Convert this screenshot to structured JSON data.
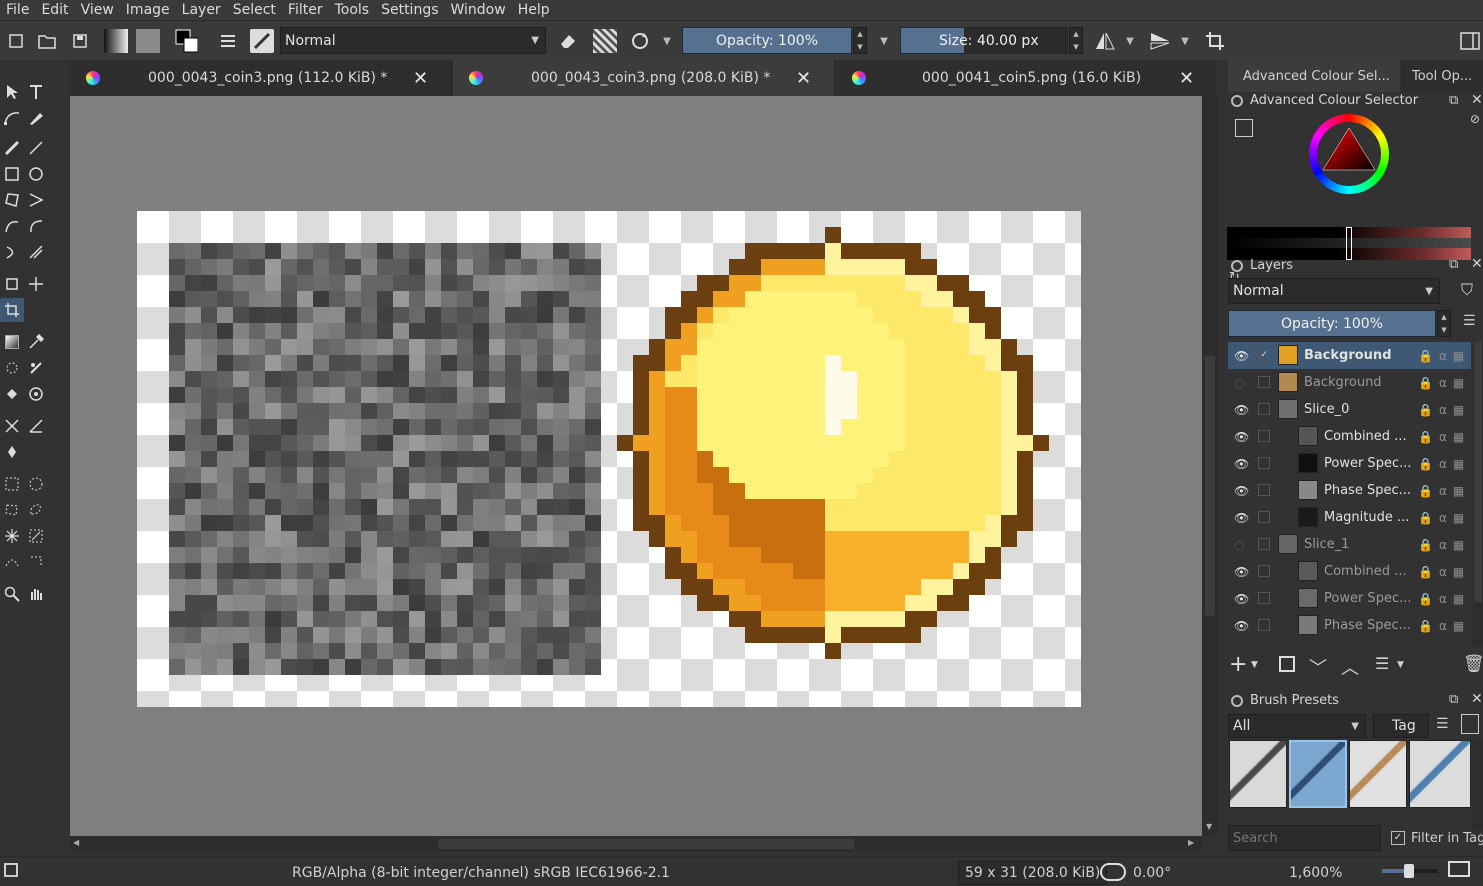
{
  "menu": [
    "File",
    "Edit",
    "View",
    "Image",
    "Layer",
    "Select",
    "Filter",
    "Tools",
    "Settings",
    "Window",
    "Help"
  ],
  "toolbar": {
    "blend_mode": "Normal",
    "opacity": "Opacity: 100%",
    "size": "Size: 40.00 px"
  },
  "tabs": [
    {
      "title": "000_0043_coin3.png (112.0 KiB) *",
      "close": "✕"
    },
    {
      "title": "000_0043_coin3.png (208.0 KiB) *",
      "close": "✕"
    },
    {
      "title": "000_0041_coin5.png (16.0 KiB)",
      "close": "✕"
    }
  ],
  "dock_tabs": [
    "Advanced Colour Sel...",
    "Tool Op..."
  ],
  "colour_selector": {
    "title": "Advanced Colour Selector"
  },
  "layers": {
    "title": "Layers",
    "blend_mode": "Normal",
    "opacity": "Opacity:  100%",
    "items": [
      {
        "name": "Background",
        "visible": true,
        "selected": true,
        "indent": 0
      },
      {
        "name": "Background",
        "visible": false,
        "selected": false,
        "indent": 0
      },
      {
        "name": "Slice_0",
        "visible": true,
        "selected": false,
        "indent": 0
      },
      {
        "name": "Combined ...",
        "visible": true,
        "selected": false,
        "indent": 1
      },
      {
        "name": "Power Spec...",
        "visible": true,
        "selected": false,
        "indent": 1
      },
      {
        "name": "Phase Spec...",
        "visible": true,
        "selected": false,
        "indent": 1
      },
      {
        "name": "Magnitude ...",
        "visible": true,
        "selected": false,
        "indent": 1
      },
      {
        "name": "Slice_1",
        "visible": false,
        "selected": false,
        "indent": 0
      },
      {
        "name": "Combined ...",
        "visible": true,
        "selected": false,
        "indent": 1
      },
      {
        "name": "Power Spec...",
        "visible": true,
        "selected": false,
        "indent": 1
      },
      {
        "name": "Phase Spec...",
        "visible": true,
        "selected": false,
        "indent": 1
      }
    ]
  },
  "brush_presets": {
    "title": "Brush Presets",
    "filter": "All",
    "tag": "Tag",
    "search_placeholder": "Search",
    "filter_in_tag": "Filter in Tag"
  },
  "status": {
    "color_space": "RGB/Alpha (8-bit integer/channel)  sRGB IEC61966-2.1",
    "dimensions": "59 x 31 (208.0 KiB)",
    "rotation": "0.00°",
    "zoom": "1,600%"
  },
  "colors": {
    "accent": "#3f5873",
    "slider": "#56708f",
    "canvas_bg": "#7f7f7f"
  }
}
